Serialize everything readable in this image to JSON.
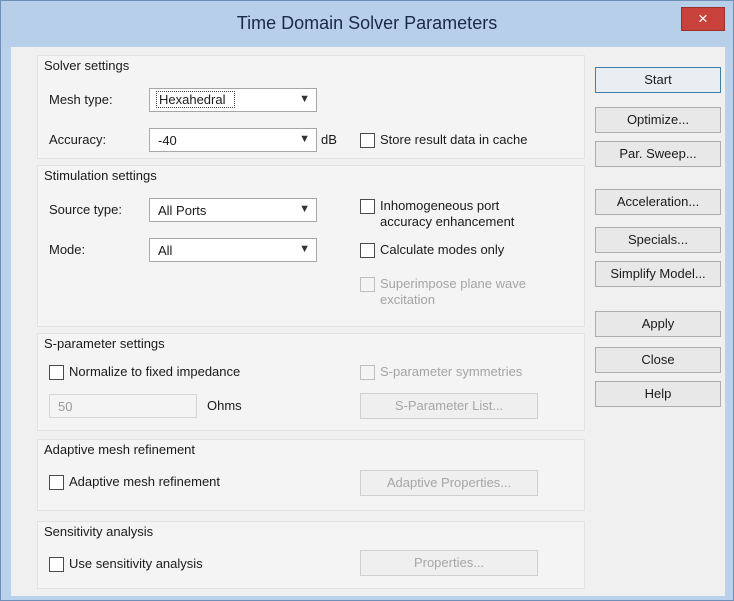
{
  "window": {
    "title": "Time Domain Solver Parameters",
    "close_glyph": "×"
  },
  "solver": {
    "title": "Solver settings",
    "mesh_label": "Mesh type:",
    "mesh_value": "Hexahedral",
    "accuracy_label": "Accuracy:",
    "accuracy_value": "-40",
    "accuracy_unit": "dB",
    "store_cache_label": "Store result data in cache"
  },
  "stimulation": {
    "title": "Stimulation settings",
    "source_label": "Source type:",
    "source_value": "All Ports",
    "mode_label": "Mode:",
    "mode_value": "All",
    "inhomog_line1": "Inhomogeneous port",
    "inhomog_line2": "accuracy enhancement",
    "calc_modes_label": "Calculate modes only",
    "superimpose_line1": "Superimpose plane wave",
    "superimpose_line2": "excitation"
  },
  "sparam": {
    "title": "S-parameter settings",
    "normalize_label": "Normalize to fixed impedance",
    "symmetries_label": "S-parameter symmetries",
    "impedance_value": "50",
    "impedance_unit": "Ohms",
    "list_button": "S-Parameter List..."
  },
  "adaptive": {
    "title": "Adaptive mesh refinement",
    "check_label": "Adaptive mesh refinement",
    "properties_button": "Adaptive Properties..."
  },
  "sensitivity": {
    "title": "Sensitivity analysis",
    "check_label": "Use sensitivity analysis",
    "properties_button": "Properties..."
  },
  "side_buttons": {
    "start": "Start",
    "optimize": "Optimize...",
    "par_sweep": "Par. Sweep...",
    "acceleration": "Acceleration...",
    "specials": "Specials...",
    "simplify": "Simplify Model...",
    "apply": "Apply",
    "close": "Close",
    "help": "Help"
  },
  "colors": {
    "title_bar": "#b7cfe9",
    "close_button": "#c8413b",
    "dialog_bg": "#f0f0f0"
  }
}
